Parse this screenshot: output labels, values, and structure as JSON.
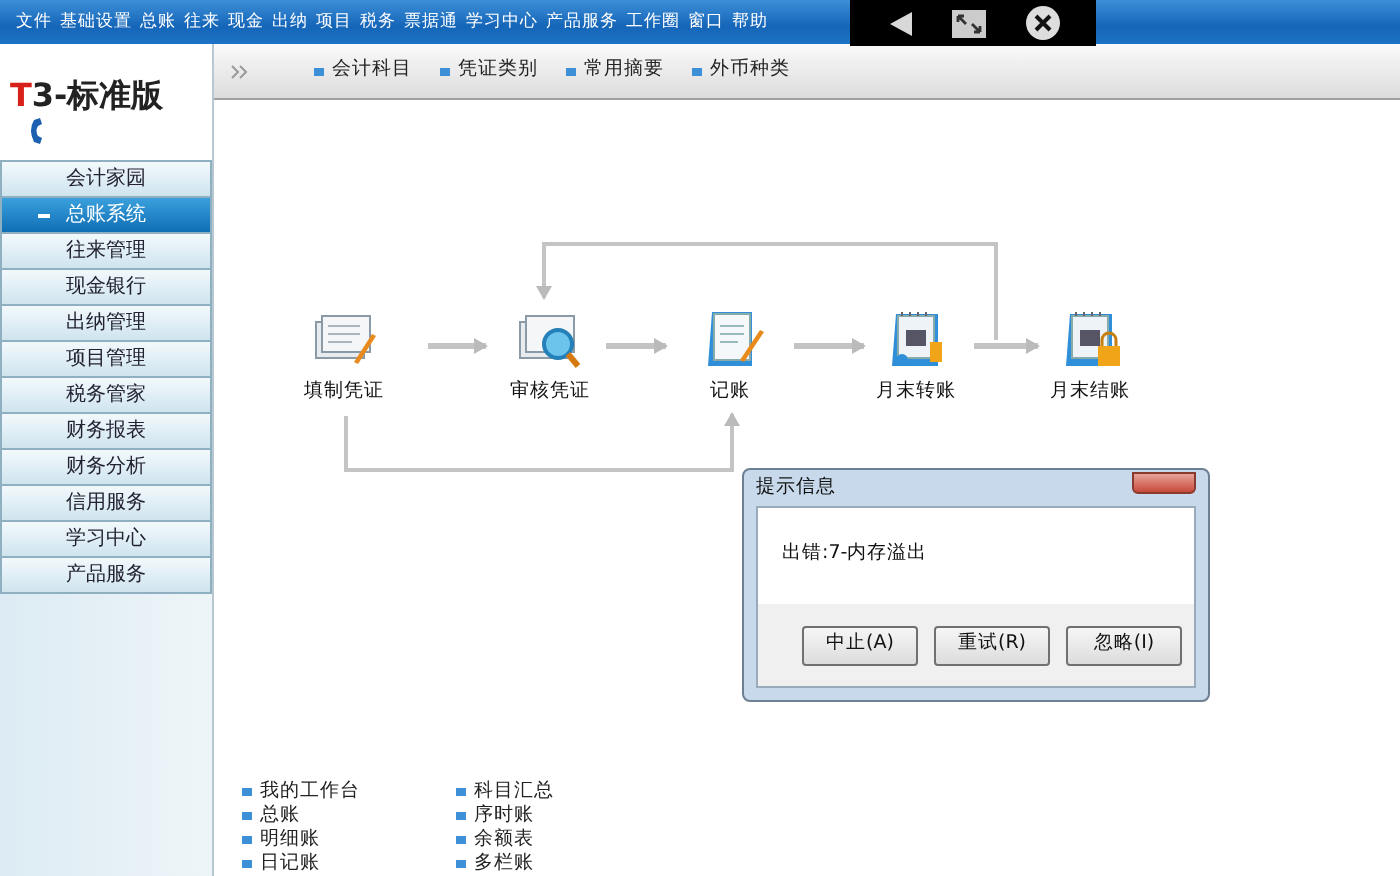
{
  "menu_bar": [
    "文件",
    "基础设置",
    "总账",
    "往来",
    "现金",
    "出纳",
    "项目",
    "税务",
    "票据通",
    "学习中心",
    "产品服务",
    "工作圈",
    "窗口",
    "帮助"
  ],
  "logo": {
    "letter": "T",
    "text": "3-标准版"
  },
  "toolbar": [
    "会计科目",
    "凭证类别",
    "常用摘要",
    "外币种类"
  ],
  "sidebar": [
    {
      "label": "会计家园",
      "selected": false,
      "expanded": false
    },
    {
      "label": "总账系统",
      "selected": true,
      "expanded": true
    },
    {
      "label": "往来管理",
      "selected": false,
      "expanded": false
    },
    {
      "label": "现金银行",
      "selected": false,
      "expanded": false
    },
    {
      "label": "出纳管理",
      "selected": false,
      "expanded": false
    },
    {
      "label": "项目管理",
      "selected": false,
      "expanded": false
    },
    {
      "label": "税务管家",
      "selected": false,
      "expanded": false
    },
    {
      "label": "财务报表",
      "selected": false,
      "expanded": false
    },
    {
      "label": "财务分析",
      "selected": false,
      "expanded": false
    },
    {
      "label": "信用服务",
      "selected": false,
      "expanded": false
    },
    {
      "label": "学习中心",
      "selected": false,
      "expanded": false
    },
    {
      "label": "产品服务",
      "selected": false,
      "expanded": false
    }
  ],
  "flow": [
    {
      "label": "填制凭证",
      "kind": "voucher"
    },
    {
      "label": "审核凭证",
      "kind": "review"
    },
    {
      "label": "记账",
      "kind": "ledger"
    },
    {
      "label": "月末转账",
      "kind": "calendar"
    },
    {
      "label": "月末结账",
      "kind": "calendar-lock"
    }
  ],
  "quick_links": [
    [
      "我的工作台",
      "总账",
      "明细账",
      "日记账"
    ],
    [
      "科目汇总",
      "序时账",
      "余额表",
      "多栏账"
    ]
  ],
  "dialog": {
    "title": "提示信息",
    "message": "出错:7-内存溢出",
    "buttons": [
      "中止(A)",
      "重试(R)",
      "忽略(I)"
    ]
  }
}
